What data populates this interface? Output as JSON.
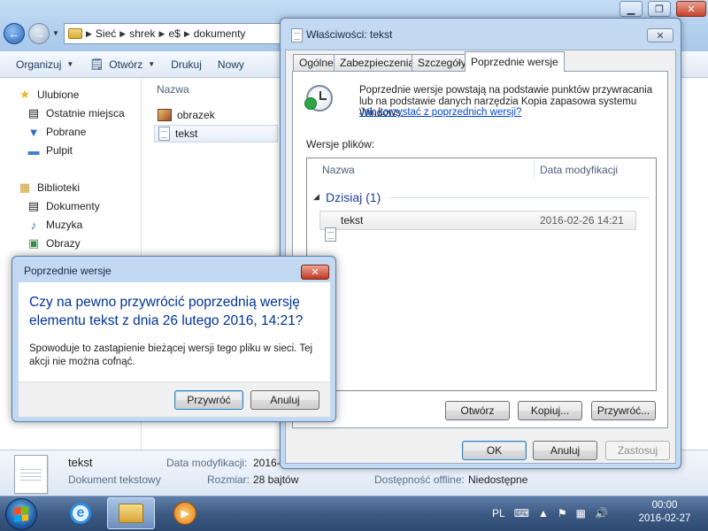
{
  "explorer": {
    "breadcrumb": [
      "Sieć",
      "shrek",
      "e$",
      "dokumenty"
    ],
    "toolbar": {
      "organize": "Organizuj",
      "open": "Otwórz",
      "print": "Drukuj",
      "new_folder": "Nowy"
    },
    "nav": {
      "favorites": "Ulubione",
      "recent": "Ostatnie miejsca",
      "downloads": "Pobrane",
      "desktop": "Pulpit",
      "libraries": "Biblioteki",
      "documents": "Dokumenty",
      "music": "Muzyka",
      "pictures": "Obrazy"
    },
    "column_name": "Nazwa",
    "files": [
      {
        "name": "obrazek",
        "icon": "image-file-icon"
      },
      {
        "name": "tekst",
        "icon": "text-file-icon"
      }
    ],
    "details": {
      "filename": "tekst",
      "filetype": "Dokument tekstowy",
      "modified_label": "Data modyfikacji:",
      "modified_value": "2016-0",
      "size_label": "Rozmiar:",
      "size_value": "28 bajtów",
      "offline_label": "Dostępność offline:",
      "offline_value": "Niedostępne"
    }
  },
  "properties": {
    "title": "Właściwości: tekst",
    "tabs": [
      "Ogólne",
      "Zabezpieczenia",
      "Szczegóły",
      "Poprzednie wersje"
    ],
    "active_tab": 3,
    "info": "Poprzednie wersje powstają na podstawie punktów przywracania lub na podstawie danych narzędzia Kopia zapasowa systemu Windows.",
    "info_link": "Jak korzystać z poprzednich wersji?",
    "versions_label": "Wersje plików:",
    "columns": {
      "name": "Nazwa",
      "date": "Data modyfikacji"
    },
    "group": "Dzisiaj (1)",
    "versions": [
      {
        "name": "tekst",
        "date": "2016-02-26 14:21"
      }
    ],
    "buttons": {
      "open": "Otwórz",
      "copy": "Kopiuj...",
      "restore": "Przywróć...",
      "ok": "OK",
      "cancel": "Anuluj",
      "apply": "Zastosuj"
    }
  },
  "confirm": {
    "title": "Poprzednie wersje",
    "question": "Czy na pewno przywrócić poprzednią wersję elementu tekst z dnia 26 lutego 2016, 14:21?",
    "warning": "Spowoduje to zastąpienie bieżącej wersji tego pliku w sieci. Tej akcji nie można cofnąć.",
    "restore_label": "Przywróć",
    "cancel_label": "Anuluj"
  },
  "taskbar": {
    "language": "PL",
    "time": "00:00",
    "date": "2016-02-27"
  },
  "colors": {
    "link": "#0046d5",
    "instruction_text": "#003399",
    "group_header": "#1e3f9a"
  }
}
